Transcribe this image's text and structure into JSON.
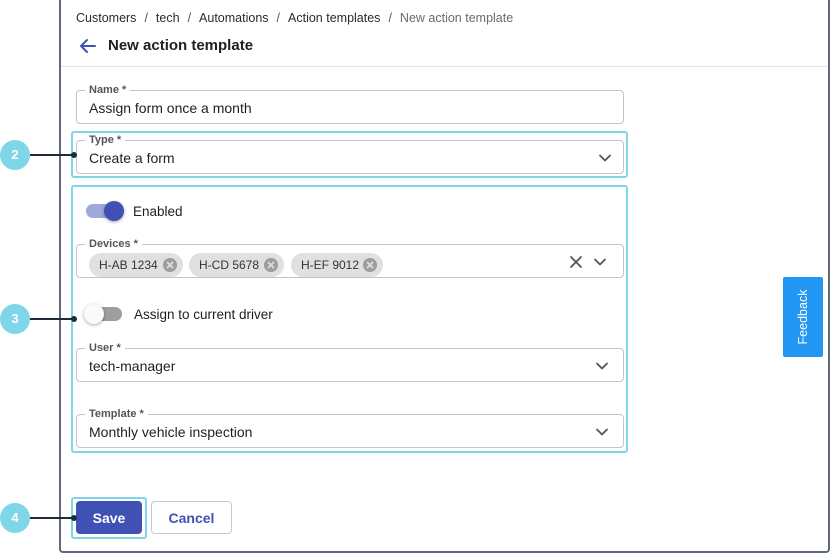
{
  "breadcrumb": [
    "Customers",
    "tech",
    "Automations",
    "Action templates",
    "New action template"
  ],
  "page_title": "New action template",
  "name_field": {
    "label": "Name *",
    "value": "Assign form once a month"
  },
  "type_field": {
    "label": "Type *",
    "value": "Create a form"
  },
  "enabled_toggle": {
    "label": "Enabled",
    "on": true
  },
  "devices_field": {
    "label": "Devices *",
    "chips": [
      "H-AB 1234",
      "H-CD 5678",
      "H-EF 9012"
    ]
  },
  "assign_toggle": {
    "label": "Assign to current driver",
    "on": false
  },
  "user_field": {
    "label": "User *",
    "value": "tech-manager"
  },
  "template_field": {
    "label": "Template *",
    "value": "Monthly vehicle inspection"
  },
  "buttons": {
    "save": "Save",
    "cancel": "Cancel"
  },
  "feedback": "Feedback",
  "callouts": [
    "2",
    "3",
    "4"
  ],
  "colors": {
    "primary": "#3f51b5",
    "highlight": "#7fd6e8",
    "feedback": "#2196f3"
  }
}
